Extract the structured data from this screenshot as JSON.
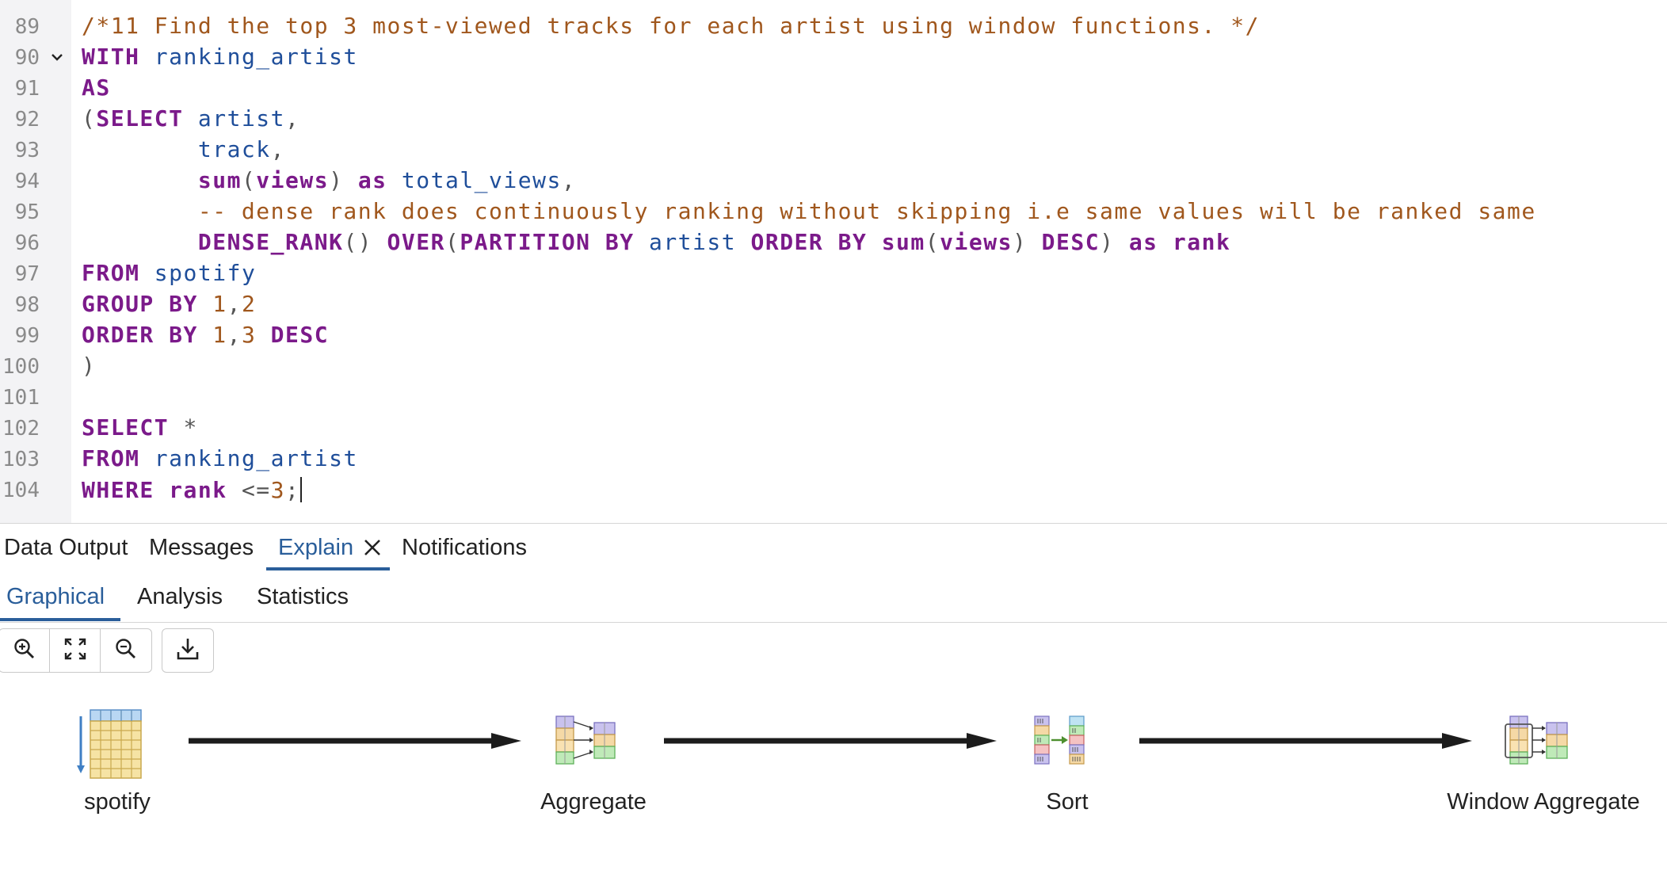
{
  "editor": {
    "lines": [
      {
        "no": "89",
        "tokens": [
          {
            "t": "/*11 Find the top 3 most-viewed tracks for each artist using window functions. */",
            "k": "cm"
          }
        ]
      },
      {
        "no": "90",
        "fold": true,
        "tokens": [
          {
            "t": "WITH",
            "k": "kw"
          },
          {
            "t": " ",
            "k": "pn"
          },
          {
            "t": "ranking_artist",
            "k": "id"
          }
        ]
      },
      {
        "no": "91",
        "tokens": [
          {
            "t": "AS",
            "k": "kw"
          }
        ]
      },
      {
        "no": "92",
        "tokens": [
          {
            "t": "(",
            "k": "pn"
          },
          {
            "t": "SELECT",
            "k": "kw"
          },
          {
            "t": " ",
            "k": "pn"
          },
          {
            "t": "artist",
            "k": "id"
          },
          {
            "t": ",",
            "k": "pn"
          }
        ]
      },
      {
        "no": "93",
        "tokens": [
          {
            "t": "        ",
            "k": "pn"
          },
          {
            "t": "track",
            "k": "id"
          },
          {
            "t": ",",
            "k": "pn"
          }
        ]
      },
      {
        "no": "94",
        "tokens": [
          {
            "t": "        ",
            "k": "pn"
          },
          {
            "t": "sum",
            "k": "fn"
          },
          {
            "t": "(",
            "k": "pn"
          },
          {
            "t": "views",
            "k": "fn"
          },
          {
            "t": ") ",
            "k": "pn"
          },
          {
            "t": "as",
            "k": "kw"
          },
          {
            "t": " ",
            "k": "pn"
          },
          {
            "t": "total_views",
            "k": "id"
          },
          {
            "t": ",",
            "k": "pn"
          }
        ]
      },
      {
        "no": "95",
        "tokens": [
          {
            "t": "        ",
            "k": "pn"
          },
          {
            "t": "-- dense rank does continuously ranking without skipping i.e same values will be ranked same",
            "k": "cm"
          }
        ]
      },
      {
        "no": "96",
        "tokens": [
          {
            "t": "        ",
            "k": "pn"
          },
          {
            "t": "DENSE_RANK",
            "k": "fn"
          },
          {
            "t": "() ",
            "k": "pn"
          },
          {
            "t": "OVER",
            "k": "kw"
          },
          {
            "t": "(",
            "k": "pn"
          },
          {
            "t": "PARTITION BY",
            "k": "kw"
          },
          {
            "t": " ",
            "k": "pn"
          },
          {
            "t": "artist",
            "k": "id"
          },
          {
            "t": " ",
            "k": "pn"
          },
          {
            "t": "ORDER BY",
            "k": "kw"
          },
          {
            "t": " ",
            "k": "pn"
          },
          {
            "t": "sum",
            "k": "fn"
          },
          {
            "t": "(",
            "k": "pn"
          },
          {
            "t": "views",
            "k": "fn"
          },
          {
            "t": ") ",
            "k": "pn"
          },
          {
            "t": "DESC",
            "k": "kw"
          },
          {
            "t": ") ",
            "k": "pn"
          },
          {
            "t": "as",
            "k": "kw"
          },
          {
            "t": " ",
            "k": "pn"
          },
          {
            "t": "rank",
            "k": "kw"
          }
        ]
      },
      {
        "no": "97",
        "tokens": [
          {
            "t": "FROM",
            "k": "kw"
          },
          {
            "t": " ",
            "k": "pn"
          },
          {
            "t": "spotify",
            "k": "id"
          }
        ]
      },
      {
        "no": "98",
        "tokens": [
          {
            "t": "GROUP BY",
            "k": "kw"
          },
          {
            "t": " ",
            "k": "pn"
          },
          {
            "t": "1",
            "k": "num"
          },
          {
            "t": ",",
            "k": "pn"
          },
          {
            "t": "2",
            "k": "num"
          }
        ]
      },
      {
        "no": "99",
        "tokens": [
          {
            "t": "ORDER BY",
            "k": "kw"
          },
          {
            "t": " ",
            "k": "pn"
          },
          {
            "t": "1",
            "k": "num"
          },
          {
            "t": ",",
            "k": "pn"
          },
          {
            "t": "3",
            "k": "num"
          },
          {
            "t": " ",
            "k": "pn"
          },
          {
            "t": "DESC",
            "k": "kw"
          }
        ]
      },
      {
        "no": "100",
        "tokens": [
          {
            "t": ")",
            "k": "pn"
          }
        ]
      },
      {
        "no": "101",
        "tokens": []
      },
      {
        "no": "102",
        "tokens": [
          {
            "t": "SELECT",
            "k": "kw"
          },
          {
            "t": " *",
            "k": "pn"
          }
        ]
      },
      {
        "no": "103",
        "tokens": [
          {
            "t": "FROM",
            "k": "kw"
          },
          {
            "t": " ",
            "k": "pn"
          },
          {
            "t": "ranking_artist",
            "k": "id"
          }
        ]
      },
      {
        "no": "104",
        "cursor": true,
        "tokens": [
          {
            "t": "WHERE",
            "k": "kw"
          },
          {
            "t": " ",
            "k": "pn"
          },
          {
            "t": "rank",
            "k": "kw"
          },
          {
            "t": " <=",
            "k": "pn"
          },
          {
            "t": "3",
            "k": "num"
          },
          {
            "t": ";",
            "k": "pn"
          }
        ]
      }
    ]
  },
  "results_tabs": [
    {
      "label": "Data Output"
    },
    {
      "label": "Messages"
    },
    {
      "label": "Explain",
      "active": true,
      "closable": true
    },
    {
      "label": "Notifications"
    }
  ],
  "explain_tabs": [
    {
      "label": "Graphical",
      "active": true
    },
    {
      "label": "Analysis"
    },
    {
      "label": "Statistics"
    }
  ],
  "toolbar": {
    "zoom_in": "zoom-in-icon",
    "fit": "fit-to-screen-icon",
    "zoom_out": "zoom-out-icon",
    "download": "download-icon"
  },
  "plan": {
    "nodes": [
      {
        "label": "spotify",
        "icon": "seq-scan-icon"
      },
      {
        "label": "Aggregate",
        "icon": "aggregate-icon"
      },
      {
        "label": "Sort",
        "icon": "sort-icon"
      },
      {
        "label": "Window Aggregate",
        "icon": "window-aggregate-icon"
      }
    ]
  },
  "colors": {
    "accent": "#2a5e9a",
    "keyword": "#7b1a8a",
    "identifier": "#1f4e9a",
    "comment": "#a0571d"
  }
}
